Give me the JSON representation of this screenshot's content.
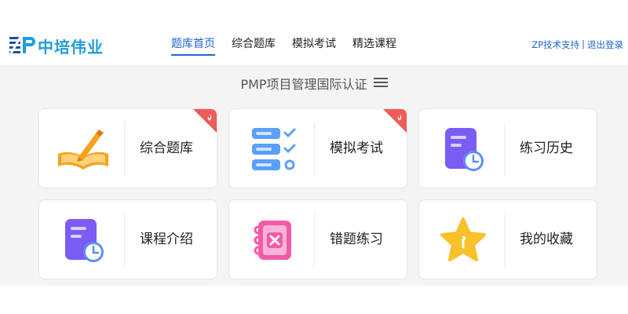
{
  "brand": {
    "name": "中培伟业",
    "logo_letters": "ZP"
  },
  "nav": {
    "items": [
      {
        "label": "题库首页",
        "active": true
      },
      {
        "label": "综合题库",
        "active": false
      },
      {
        "label": "模拟考试",
        "active": false
      },
      {
        "label": "精选课程",
        "active": false
      }
    ]
  },
  "user_links": {
    "support": "ZP技术支持",
    "separator": "|",
    "logout": "退出登录"
  },
  "page_title": "PMP项目管理国际认证",
  "cards": [
    {
      "label": "综合题库",
      "icon": "open-book-pencil-icon",
      "hot": true
    },
    {
      "label": "模拟考试",
      "icon": "checklist-icon",
      "hot": true
    },
    {
      "label": "练习历史",
      "icon": "document-clock-icon",
      "hot": false
    },
    {
      "label": "课程介绍",
      "icon": "document-clock-icon",
      "hot": false
    },
    {
      "label": "错题练习",
      "icon": "notebook-x-icon",
      "hot": false
    },
    {
      "label": "我的收藏",
      "icon": "star-icon",
      "hot": false
    }
  ],
  "colors": {
    "accent": "#1e66c8",
    "brand": "#1f9ed8",
    "hot_badge": "#f05a5a",
    "background": "#f4f4f4"
  }
}
